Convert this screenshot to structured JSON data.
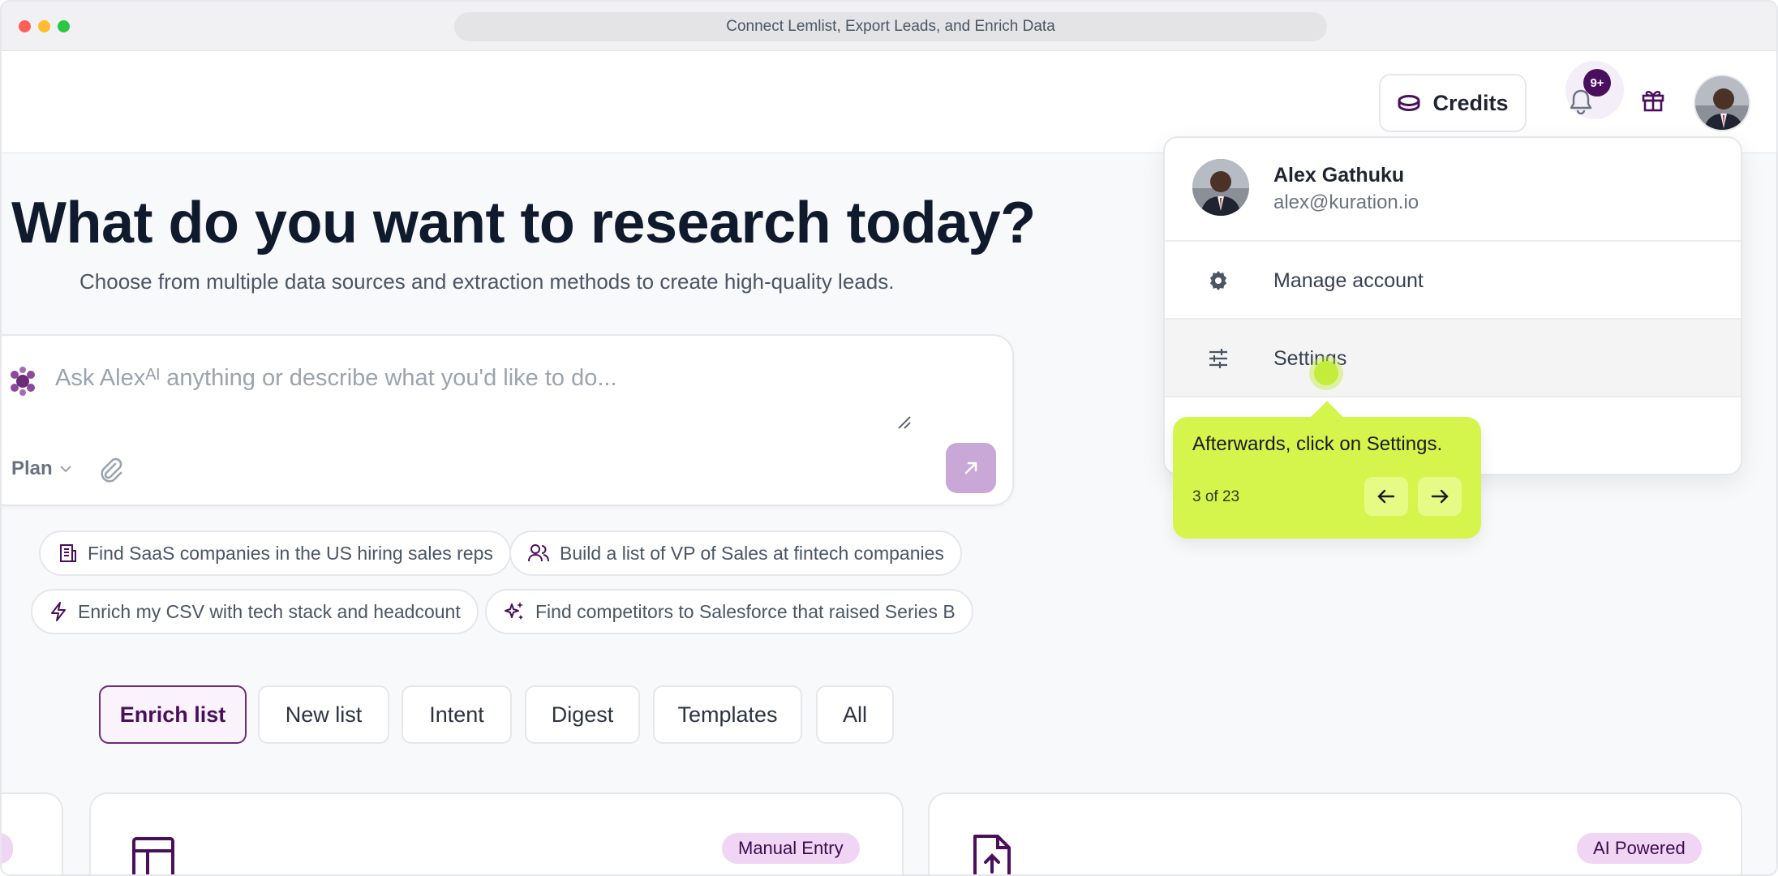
{
  "window": {
    "title": "Connect Lemlist, Export Leads, and Enrich Data"
  },
  "header": {
    "credits_label": "Credits",
    "notifications_badge": "9+"
  },
  "hero": {
    "title": "What do you want to research today?",
    "subtitle": "Choose from multiple data sources and extraction methods to create high-quality leads."
  },
  "prompt": {
    "placeholder": "Ask Alexᴬᴵ anything or describe what you'd like to do...",
    "plan_label": "Plan"
  },
  "suggestions": [
    {
      "label": "Find SaaS companies in the US hiring sales reps",
      "icon": "building-icon"
    },
    {
      "label": "Build a list of VP of Sales at fintech companies",
      "icon": "users-icon"
    },
    {
      "label": "Enrich my CSV with tech stack and headcount",
      "icon": "bolt-icon"
    },
    {
      "label": "Find competitors to Salesforce that raised Series B",
      "icon": "sparkles-icon"
    }
  ],
  "tabs": [
    {
      "label": "Enrich list",
      "active": true
    },
    {
      "label": "New list"
    },
    {
      "label": "Intent"
    },
    {
      "label": "Digest"
    },
    {
      "label": "Templates"
    },
    {
      "label": "All"
    }
  ],
  "cards": [
    {
      "badge": "t"
    },
    {
      "badge": "Manual Entry",
      "icon": "table-icon"
    },
    {
      "badge": "AI Powered",
      "icon": "file-upload-icon"
    }
  ],
  "user_menu": {
    "name": "Alex Gathuku",
    "email": "alex@kuration.io",
    "items": [
      {
        "label": "Manage account",
        "icon": "gear-icon"
      },
      {
        "label": "Settings",
        "icon": "sliders-icon"
      }
    ]
  },
  "tour": {
    "text": "Afterwards, click on Settings.",
    "step": "3 of 23"
  },
  "colors": {
    "brand": "#4a0f5c",
    "tour_bg": "#d5f54d",
    "pill_bg": "#f1d5f4"
  }
}
